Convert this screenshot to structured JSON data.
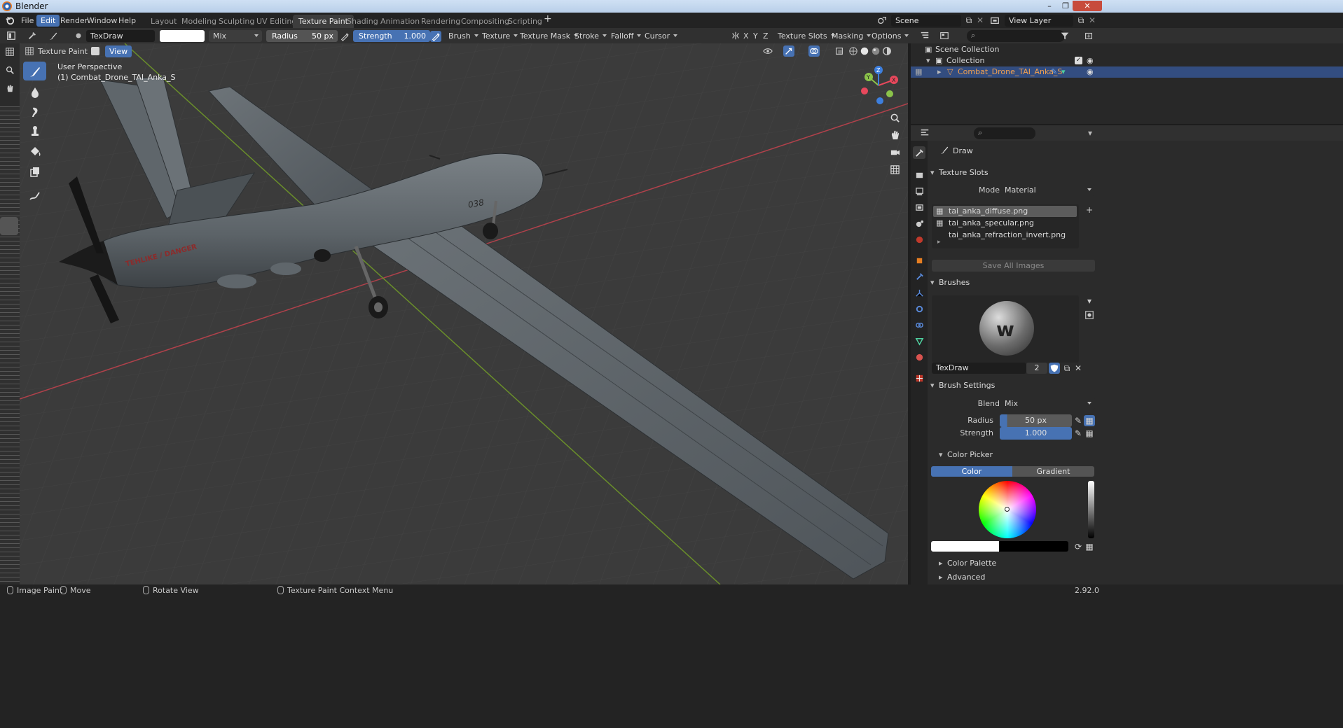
{
  "window": {
    "title": "Blender"
  },
  "menu": [
    "File",
    "Edit",
    "Render",
    "Window",
    "Help"
  ],
  "active_menu": "Edit",
  "workspaces": [
    "Layout",
    "Modeling",
    "Sculpting",
    "UV Editing",
    "Texture Paint",
    "Shading",
    "Animation",
    "Rendering",
    "Compositing",
    "Scripting"
  ],
  "active_workspace": "Texture Paint",
  "scene": {
    "name": "Scene",
    "view_layer": "View Layer"
  },
  "tool_header": {
    "brush_name": "TexDraw",
    "blend": "Mix",
    "radius_label": "Radius",
    "radius_value": "50 px",
    "strength_label": "Strength",
    "strength_value": "1.000",
    "menus": [
      "Brush",
      "Texture",
      "Texture Mask",
      "Stroke",
      "Falloff",
      "Cursor"
    ],
    "axes": [
      "X",
      "Y",
      "Z"
    ],
    "right_menus": [
      "Texture Slots",
      "Masking",
      "Options"
    ]
  },
  "viewport_header": {
    "mode": "Texture Paint",
    "view_menu": "View"
  },
  "viewport": {
    "perspective": "User Perspective",
    "object_line": "(1) Combat_Drone_TAI_Anka_S",
    "fuselage_text": "TEHLIKE / DANGER",
    "tail_number": "038"
  },
  "outliner": {
    "root": "Scene Collection",
    "collection": "Collection",
    "object": "Combat_Drone_TAI_Anka_S"
  },
  "properties": {
    "tool_name": "Draw",
    "texture_slots": {
      "header": "Texture Slots",
      "mode_label": "Mode",
      "mode_value": "Material",
      "slots": [
        "tai_anka_diffuse.png",
        "tai_anka_specular.png",
        "tai_anka_refraction_invert.png"
      ],
      "save_button": "Save All Images"
    },
    "brushes": {
      "header": "Brushes",
      "name": "TexDraw",
      "users": "2"
    },
    "brush_settings": {
      "header": "Brush Settings",
      "blend_label": "Blend",
      "blend_value": "Mix",
      "radius_label": "Radius",
      "radius_value": "50 px",
      "strength_label": "Strength",
      "strength_value": "1.000",
      "color_picker": "Color Picker",
      "tab_color": "Color",
      "tab_gradient": "Gradient",
      "color_palette": "Color Palette",
      "advanced": "Advanced"
    }
  },
  "status": {
    "image_paint": "Image Paint",
    "move": "Move",
    "rotate": "Rotate View",
    "context": "Texture Paint Context Menu",
    "version": "2.92.0"
  },
  "colors": {
    "accent": "#4772b3",
    "axis_x": "#e8485c",
    "axis_y": "#8bc34a",
    "axis_z": "#3d7fde"
  }
}
